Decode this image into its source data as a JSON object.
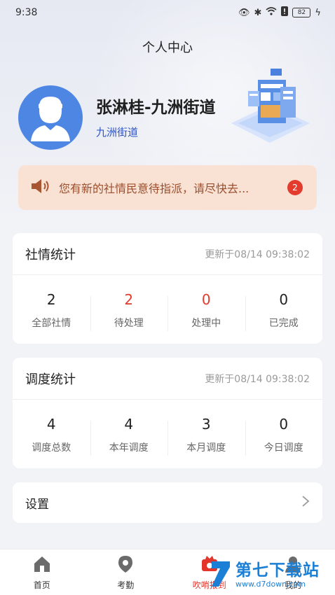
{
  "status_bar": {
    "time": "9:38",
    "battery": "82"
  },
  "header": {
    "title": "个人中心"
  },
  "profile": {
    "name": "张淋桂-九洲街道",
    "district": "九洲街道"
  },
  "notice": {
    "text": "您有新的社情民意待指派，请尽快去...",
    "badge": "2"
  },
  "social_stats": {
    "title": "社情统计",
    "updated": "更新于08/14 09:38:02",
    "items": [
      {
        "value": "2",
        "label": "全部社情"
      },
      {
        "value": "2",
        "label": "待处理"
      },
      {
        "value": "0",
        "label": "处理中"
      },
      {
        "value": "0",
        "label": "已完成"
      }
    ]
  },
  "dispatch_stats": {
    "title": "调度统计",
    "updated": "更新于08/14 09:38:02",
    "items": [
      {
        "value": "4",
        "label": "调度总数"
      },
      {
        "value": "4",
        "label": "本年调度"
      },
      {
        "value": "3",
        "label": "本月调度"
      },
      {
        "value": "0",
        "label": "今日调度"
      }
    ]
  },
  "settings": {
    "label": "设置"
  },
  "tabbar": {
    "items": [
      {
        "label": "首页"
      },
      {
        "label": "考勤"
      },
      {
        "label": "吹哨报到"
      },
      {
        "label": "我的"
      }
    ]
  },
  "watermark": {
    "title": "第七下载站",
    "url": "www.d7down.com"
  },
  "colors": {
    "accent_red": "#e23a2c",
    "avatar_blue": "#4e86e4",
    "notice_bg": "#f9e2d3"
  }
}
